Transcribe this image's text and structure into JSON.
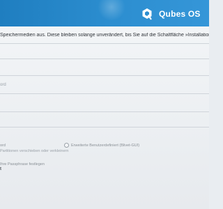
{
  "brand": {
    "name": "Qubes OS",
    "color": "#2c8ed0",
    "icon": "qubes-logo-icon"
  },
  "content": {
    "instruction": "Speichermedien aus. Diese bleiben solange unverändert, bis Sie auf die Schaltfläche »Installation sta",
    "field_hint": "ord",
    "option_left": "ord",
    "option_right": "Erweiterte Benutzerdefiniert (Blivet-GUI)",
    "subhint": "Partitionen verschieben oder verkleinern",
    "passphrase": "Ihre Passphrase festlegen",
    "mark": "t"
  }
}
